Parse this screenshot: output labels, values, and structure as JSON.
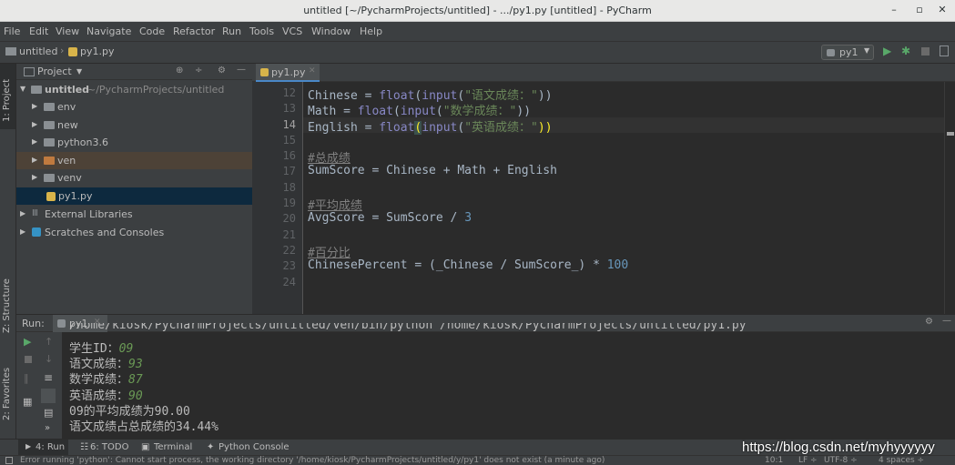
{
  "window": {
    "title": "untitled [~/PycharmProjects/untitled] - .../py1.py [untitled] - PyCharm",
    "min": "–",
    "max": "▫",
    "close": "✕"
  },
  "menu": [
    "File",
    "Edit",
    "View",
    "Navigate",
    "Code",
    "Refactor",
    "Run",
    "Tools",
    "VCS",
    "Window",
    "Help"
  ],
  "nav": {
    "crumb1": "untitled",
    "crumb2": "py1.py",
    "run_config": "py1"
  },
  "left_strip": {
    "project_tab": "1: Project",
    "structure_tab": "Z: Structure",
    "favorites_tab": "2: Favorites"
  },
  "project_panel": {
    "title": "Project",
    "root_name": "untitled",
    "root_path": "~/PycharmProjects/untitled",
    "items": [
      "env",
      "new",
      "python3.6",
      "ven",
      "venv",
      "py1.py"
    ],
    "external": "External Libraries",
    "scratches": "Scratches and Consoles"
  },
  "editor": {
    "tab": "py1.py",
    "line_numbers": [
      "12",
      "13",
      "14",
      "15",
      "16",
      "17",
      "18",
      "19",
      "20",
      "21",
      "22",
      "23",
      "24"
    ],
    "lines": {
      "l12a": "Chinese = ",
      "l12b": "float",
      "l12c": "(",
      "l12d": "input",
      "l12e": "(",
      "l12f": "\"语文成绩：\"",
      "l12g": "))",
      "l13a": "Math = ",
      "l13b": "float",
      "l13c": "(",
      "l13d": "input",
      "l13e": "(",
      "l13f": "\"数学成绩：\"",
      "l13g": "))",
      "l14a": "English = ",
      "l14b": "float",
      "l14c": "(",
      "l14d": "input",
      "l14e": "(",
      "l14f": "\"英语成绩：\"",
      "l14g": "))",
      "l16": "#总成绩",
      "l17": "SumScore = Chinese + Math + English",
      "l19": "#平均成绩",
      "l20a": "AvgScore = SumScore / ",
      "l20b": "3",
      "l22": "#百分比",
      "l23a": "ChinesePercent = (_Chinese / SumScore_) * ",
      "l23b": "100"
    }
  },
  "run": {
    "label": "Run:",
    "tab": "py1",
    "console_path": "/home/kiosk/PycharmProjects/untitled/ven/bin/python /home/kiosk/PycharmProjects/untitled/py1.py",
    "lines": [
      {
        "prompt": "学生ID：",
        "input": "09"
      },
      {
        "prompt": "语文成绩：",
        "input": "93"
      },
      {
        "prompt": "数学成绩：",
        "input": "87"
      },
      {
        "prompt": "英语成绩：",
        "input": "90"
      }
    ],
    "out1": "09的平均成绩为90.00",
    "out2": "语文成绩占总成绩的34.44%"
  },
  "bottom_tabs": {
    "run": "4: Run",
    "todo": "6: TODO",
    "terminal": "Terminal",
    "python_console": "Python Console"
  },
  "status": {
    "message": "Error running 'python': Cannot start process, the working directory '/home/kiosk/PycharmProjects/untitled/y/py1' does not exist (a minute ago)",
    "position": "10:1",
    "lf": "LF ÷",
    "encoding": "UTF-8 ÷",
    "indent": "4 spaces ÷"
  },
  "watermark": "https://blog.csdn.net/myhyyyyyy"
}
